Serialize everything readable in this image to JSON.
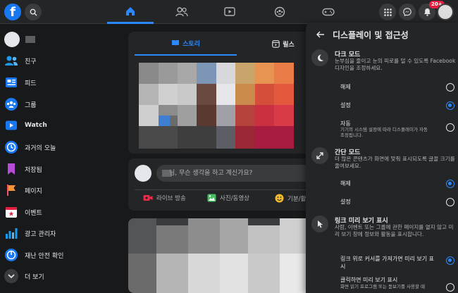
{
  "topbar": {
    "logo_letter": "f",
    "notifications_badge": "20+"
  },
  "sidebar": {
    "items": [
      {
        "label": "친구",
        "icon": "friends-icon"
      },
      {
        "label": "피드",
        "icon": "feed-icon"
      },
      {
        "label": "그룹",
        "icon": "groups-icon"
      },
      {
        "label": "Watch",
        "icon": "watch-icon"
      },
      {
        "label": "과거의 오늘",
        "icon": "memories-icon"
      },
      {
        "label": "저장됨",
        "icon": "saved-icon"
      },
      {
        "label": "페이지",
        "icon": "pages-icon"
      },
      {
        "label": "이벤트",
        "icon": "events-icon"
      },
      {
        "label": "광고 관리자",
        "icon": "ads-manager-icon"
      },
      {
        "label": "재난 안전 확인",
        "icon": "crisis-response-icon"
      },
      {
        "label": "더 보기",
        "icon": "chevron-down-icon"
      }
    ]
  },
  "stories": {
    "tab_stories": "스토리",
    "tab_reels": "릴스"
  },
  "composer": {
    "placeholder": "님, 무슨 생각을 하고 계신가요?",
    "live_label": "라이브 방송",
    "photo_label": "사진/동영상",
    "feeling_label": "기분/활동"
  },
  "panel": {
    "title": "디스플레이 및 접근성",
    "dark_mode": {
      "title": "다크 모드",
      "description": "눈부심을 줄이고 눈의 피로를 덜 수 있도록 Facebook 디자인을 조정하세요.",
      "options": [
        {
          "label": "해제",
          "selected": false
        },
        {
          "label": "설정",
          "selected": true
        },
        {
          "label": "자동",
          "sub": "기기의 시스템 설정에 따라 디스플레이가 자동 조정됩니다.",
          "selected": false
        }
      ]
    },
    "compact_mode": {
      "title": "간단 모드",
      "description": "더 많은 콘텐츠가 화면에 맞춰 표시되도록 글꼴 크기를 줄여보세요.",
      "options": [
        {
          "label": "해제",
          "selected": true
        },
        {
          "label": "설정",
          "selected": false
        }
      ]
    },
    "link_preview": {
      "title": "링크 미리 보기 표시",
      "description": "사람, 이벤트 또는 그룹에 관한 페이지를 열지 않고 미리 보기 창에 정보와 활동을 표시합니다.",
      "options": [
        {
          "label": "링크 위로 커서를 가져가면 미리 보기 표시",
          "selected": true
        },
        {
          "label": "클릭하면 미리 보기 표시",
          "sub": "화면 읽기 프로그램 또는 돋보기를 사용할 때",
          "selected": false
        }
      ]
    }
  },
  "colors": {
    "accent": "#2d88ff",
    "background": "#18191a",
    "surface": "#242526",
    "badge": "#e41e3f"
  }
}
